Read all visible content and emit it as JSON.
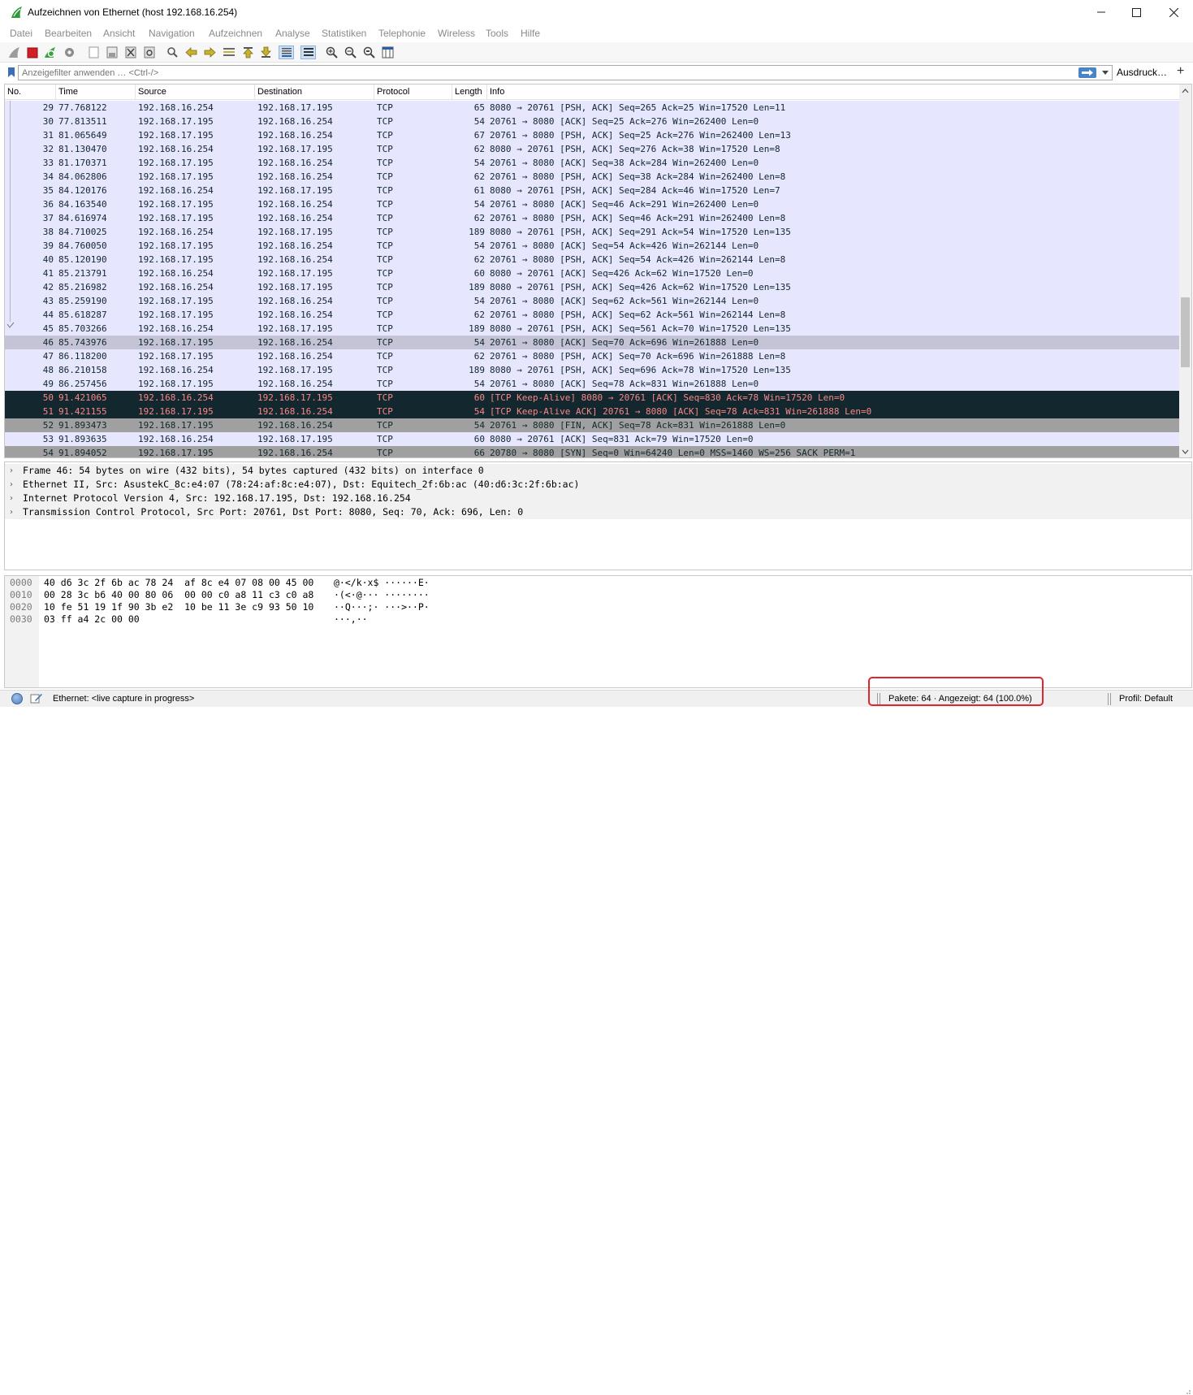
{
  "window": {
    "title": "Aufzeichnen von Ethernet (host 192.168.16.254)"
  },
  "menu": [
    "Datei",
    "Bearbeiten",
    "Ansicht",
    "Navigation",
    "Aufzeichnen",
    "Analyse",
    "Statistiken",
    "Telephonie",
    "Wireless",
    "Tools",
    "Hilfe"
  ],
  "filter": {
    "placeholder": "Anzeigefilter anwenden … <Ctrl-/>",
    "expression_label": "Ausdruck…",
    "add_label": "+"
  },
  "columns": {
    "no": "No.",
    "time": "Time",
    "source": "Source",
    "destination": "Destination",
    "protocol": "Protocol",
    "length": "Length",
    "info": "Info"
  },
  "packets": [
    {
      "no": "29",
      "time": "77.768122",
      "src": "192.168.16.254",
      "dst": "192.168.17.195",
      "proto": "TCP",
      "len": "65",
      "info": "8080 → 20761 [PSH, ACK] Seq=265 Ack=25 Win=17520 Len=11",
      "style": "normal"
    },
    {
      "no": "30",
      "time": "77.813511",
      "src": "192.168.17.195",
      "dst": "192.168.16.254",
      "proto": "TCP",
      "len": "54",
      "info": "20761 → 8080 [ACK] Seq=25 Ack=276 Win=262400 Len=0",
      "style": "normal"
    },
    {
      "no": "31",
      "time": "81.065649",
      "src": "192.168.17.195",
      "dst": "192.168.16.254",
      "proto": "TCP",
      "len": "67",
      "info": "20761 → 8080 [PSH, ACK] Seq=25 Ack=276 Win=262400 Len=13",
      "style": "normal"
    },
    {
      "no": "32",
      "time": "81.130470",
      "src": "192.168.16.254",
      "dst": "192.168.17.195",
      "proto": "TCP",
      "len": "62",
      "info": "8080 → 20761 [PSH, ACK] Seq=276 Ack=38 Win=17520 Len=8",
      "style": "normal"
    },
    {
      "no": "33",
      "time": "81.170371",
      "src": "192.168.17.195",
      "dst": "192.168.16.254",
      "proto": "TCP",
      "len": "54",
      "info": "20761 → 8080 [ACK] Seq=38 Ack=284 Win=262400 Len=0",
      "style": "normal"
    },
    {
      "no": "34",
      "time": "84.062806",
      "src": "192.168.17.195",
      "dst": "192.168.16.254",
      "proto": "TCP",
      "len": "62",
      "info": "20761 → 8080 [PSH, ACK] Seq=38 Ack=284 Win=262400 Len=8",
      "style": "normal"
    },
    {
      "no": "35",
      "time": "84.120176",
      "src": "192.168.16.254",
      "dst": "192.168.17.195",
      "proto": "TCP",
      "len": "61",
      "info": "8080 → 20761 [PSH, ACK] Seq=284 Ack=46 Win=17520 Len=7",
      "style": "normal"
    },
    {
      "no": "36",
      "time": "84.163540",
      "src": "192.168.17.195",
      "dst": "192.168.16.254",
      "proto": "TCP",
      "len": "54",
      "info": "20761 → 8080 [ACK] Seq=46 Ack=291 Win=262400 Len=0",
      "style": "normal"
    },
    {
      "no": "37",
      "time": "84.616974",
      "src": "192.168.17.195",
      "dst": "192.168.16.254",
      "proto": "TCP",
      "len": "62",
      "info": "20761 → 8080 [PSH, ACK] Seq=46 Ack=291 Win=262400 Len=8",
      "style": "normal"
    },
    {
      "no": "38",
      "time": "84.710025",
      "src": "192.168.16.254",
      "dst": "192.168.17.195",
      "proto": "TCP",
      "len": "189",
      "info": "8080 → 20761 [PSH, ACK] Seq=291 Ack=54 Win=17520 Len=135",
      "style": "normal"
    },
    {
      "no": "39",
      "time": "84.760050",
      "src": "192.168.17.195",
      "dst": "192.168.16.254",
      "proto": "TCP",
      "len": "54",
      "info": "20761 → 8080 [ACK] Seq=54 Ack=426 Win=262144 Len=0",
      "style": "normal"
    },
    {
      "no": "40",
      "time": "85.120190",
      "src": "192.168.17.195",
      "dst": "192.168.16.254",
      "proto": "TCP",
      "len": "62",
      "info": "20761 → 8080 [PSH, ACK] Seq=54 Ack=426 Win=262144 Len=8",
      "style": "normal"
    },
    {
      "no": "41",
      "time": "85.213791",
      "src": "192.168.16.254",
      "dst": "192.168.17.195",
      "proto": "TCP",
      "len": "60",
      "info": "8080 → 20761 [ACK] Seq=426 Ack=62 Win=17520 Len=0",
      "style": "normal"
    },
    {
      "no": "42",
      "time": "85.216982",
      "src": "192.168.16.254",
      "dst": "192.168.17.195",
      "proto": "TCP",
      "len": "189",
      "info": "8080 → 20761 [PSH, ACK] Seq=426 Ack=62 Win=17520 Len=135",
      "style": "normal"
    },
    {
      "no": "43",
      "time": "85.259190",
      "src": "192.168.17.195",
      "dst": "192.168.16.254",
      "proto": "TCP",
      "len": "54",
      "info": "20761 → 8080 [ACK] Seq=62 Ack=561 Win=262144 Len=0",
      "style": "normal"
    },
    {
      "no": "44",
      "time": "85.618287",
      "src": "192.168.17.195",
      "dst": "192.168.16.254",
      "proto": "TCP",
      "len": "62",
      "info": "20761 → 8080 [PSH, ACK] Seq=62 Ack=561 Win=262144 Len=8",
      "style": "normal"
    },
    {
      "no": "45",
      "time": "85.703266",
      "src": "192.168.16.254",
      "dst": "192.168.17.195",
      "proto": "TCP",
      "len": "189",
      "info": "8080 → 20761 [PSH, ACK] Seq=561 Ack=70 Win=17520 Len=135",
      "style": "normal"
    },
    {
      "no": "46",
      "time": "85.743976",
      "src": "192.168.17.195",
      "dst": "192.168.16.254",
      "proto": "TCP",
      "len": "54",
      "info": "20761 → 8080 [ACK] Seq=70 Ack=696 Win=261888 Len=0",
      "style": "sel"
    },
    {
      "no": "47",
      "time": "86.118200",
      "src": "192.168.17.195",
      "dst": "192.168.16.254",
      "proto": "TCP",
      "len": "62",
      "info": "20761 → 8080 [PSH, ACK] Seq=70 Ack=696 Win=261888 Len=8",
      "style": "normal"
    },
    {
      "no": "48",
      "time": "86.210158",
      "src": "192.168.16.254",
      "dst": "192.168.17.195",
      "proto": "TCP",
      "len": "189",
      "info": "8080 → 20761 [PSH, ACK] Seq=696 Ack=78 Win=17520 Len=135",
      "style": "normal"
    },
    {
      "no": "49",
      "time": "86.257456",
      "src": "192.168.17.195",
      "dst": "192.168.16.254",
      "proto": "TCP",
      "len": "54",
      "info": "20761 → 8080 [ACK] Seq=78 Ack=831 Win=261888 Len=0",
      "style": "normal"
    },
    {
      "no": "50",
      "time": "91.421065",
      "src": "192.168.16.254",
      "dst": "192.168.17.195",
      "proto": "TCP",
      "len": "60",
      "info": "[TCP Keep-Alive] 8080 → 20761 [ACK] Seq=830 Ack=78 Win=17520 Len=0",
      "style": "alert"
    },
    {
      "no": "51",
      "time": "91.421155",
      "src": "192.168.17.195",
      "dst": "192.168.16.254",
      "proto": "TCP",
      "len": "54",
      "info": "[TCP Keep-Alive ACK] 20761 → 8080 [ACK] Seq=78 Ack=831 Win=261888 Len=0",
      "style": "alert"
    },
    {
      "no": "52",
      "time": "91.893473",
      "src": "192.168.17.195",
      "dst": "192.168.16.254",
      "proto": "TCP",
      "len": "54",
      "info": "20761 → 8080 [FIN, ACK] Seq=78 Ack=831 Win=261888 Len=0",
      "style": "fin"
    },
    {
      "no": "53",
      "time": "91.893635",
      "src": "192.168.16.254",
      "dst": "192.168.17.195",
      "proto": "TCP",
      "len": "60",
      "info": "8080 → 20761 [ACK] Seq=831 Ack=79 Win=17520 Len=0",
      "style": "normal"
    },
    {
      "no": "54",
      "time": "91.894052",
      "src": "192.168.17.195",
      "dst": "192.168.16.254",
      "proto": "TCP",
      "len": "66",
      "info": "20780 → 8080 [SYN] Seq=0 Win=64240 Len=0 MSS=1460 WS=256 SACK_PERM=1",
      "style": "fin"
    }
  ],
  "details": [
    "Frame 46: 54 bytes on wire (432 bits), 54 bytes captured (432 bits) on interface 0",
    "Ethernet II, Src: AsustekC_8c:e4:07 (78:24:af:8c:e4:07), Dst: Equitech_2f:6b:ac (40:d6:3c:2f:6b:ac)",
    "Internet Protocol Version 4, Src: 192.168.17.195, Dst: 192.168.16.254",
    "Transmission Control Protocol, Src Port: 20761, Dst Port: 8080, Seq: 70, Ack: 696, Len: 0"
  ],
  "hexdump": [
    {
      "offset": "0000",
      "hex": "40 d6 3c 2f 6b ac 78 24  af 8c e4 07 08 00 45 00",
      "ascii": "@·</k·x$ ······E·"
    },
    {
      "offset": "0010",
      "hex": "00 28 3c b6 40 00 80 06  00 00 c0 a8 11 c3 c0 a8",
      "ascii": "·(<·@··· ········"
    },
    {
      "offset": "0020",
      "hex": "10 fe 51 19 1f 90 3b e2  10 be 11 3e c9 93 50 10",
      "ascii": "··Q···;· ···>··P·"
    },
    {
      "offset": "0030",
      "hex": "03 ff a4 2c 00 00",
      "ascii": "···,··"
    }
  ],
  "status": {
    "capture_text": "Ethernet: <live capture in progress>",
    "packets_text": "Pakete: 64 · Angezeigt: 64 (100.0%)",
    "profile_text": "Profil: Default"
  },
  "colors": {
    "row_normal": "#e7e6ff",
    "row_selected": "#c4c4d6",
    "row_alert_bg": "#12272e",
    "row_alert_fg": "#f78787",
    "row_fin": "#a0a0a0",
    "highlight": "#e0252b"
  }
}
